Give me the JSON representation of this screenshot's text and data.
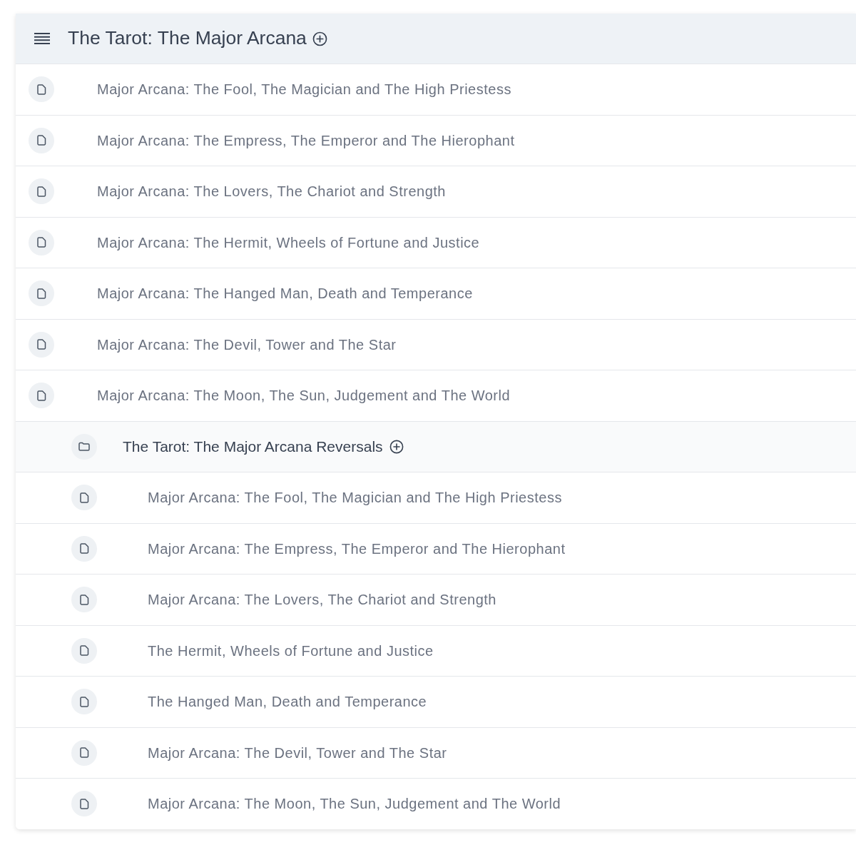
{
  "list": {
    "title": "The Tarot: The Major Arcana",
    "items": [
      {
        "kind": "document",
        "title": "Major Arcana: The Fool, The Magician and The High Priestess"
      },
      {
        "kind": "document",
        "title": "Major Arcana: The Empress, The Emperor and The Hierophant"
      },
      {
        "kind": "document",
        "title": "Major Arcana: The Lovers, The Chariot and Strength"
      },
      {
        "kind": "document",
        "title": "Major Arcana: The Hermit, Wheels of Fortune and Justice"
      },
      {
        "kind": "document",
        "title": "Major Arcana: The Hanged Man, Death and Temperance"
      },
      {
        "kind": "document",
        "title": "Major Arcana: The Devil, Tower and The Star"
      },
      {
        "kind": "document",
        "title": "Major Arcana: The Moon, The Sun, Judgement and The World"
      },
      {
        "kind": "folder",
        "title": "The Tarot: The Major Arcana Reversals",
        "children": [
          {
            "kind": "document",
            "title": "Major Arcana: The Fool, The Magician and The High Priestess"
          },
          {
            "kind": "document",
            "title": "Major Arcana: The Empress, The Emperor and The Hierophant"
          },
          {
            "kind": "document",
            "title": "Major Arcana: The Lovers, The Chariot and Strength"
          },
          {
            "kind": "document",
            "title": "The Hermit, Wheels of Fortune and Justice"
          },
          {
            "kind": "document",
            "title": "The Hanged Man, Death and Temperance"
          },
          {
            "kind": "document",
            "title": "Major Arcana: The Devil, Tower and The Star"
          },
          {
            "kind": "document",
            "title": "Major Arcana: The Moon, The Sun, Judgement and The World"
          }
        ]
      }
    ]
  }
}
